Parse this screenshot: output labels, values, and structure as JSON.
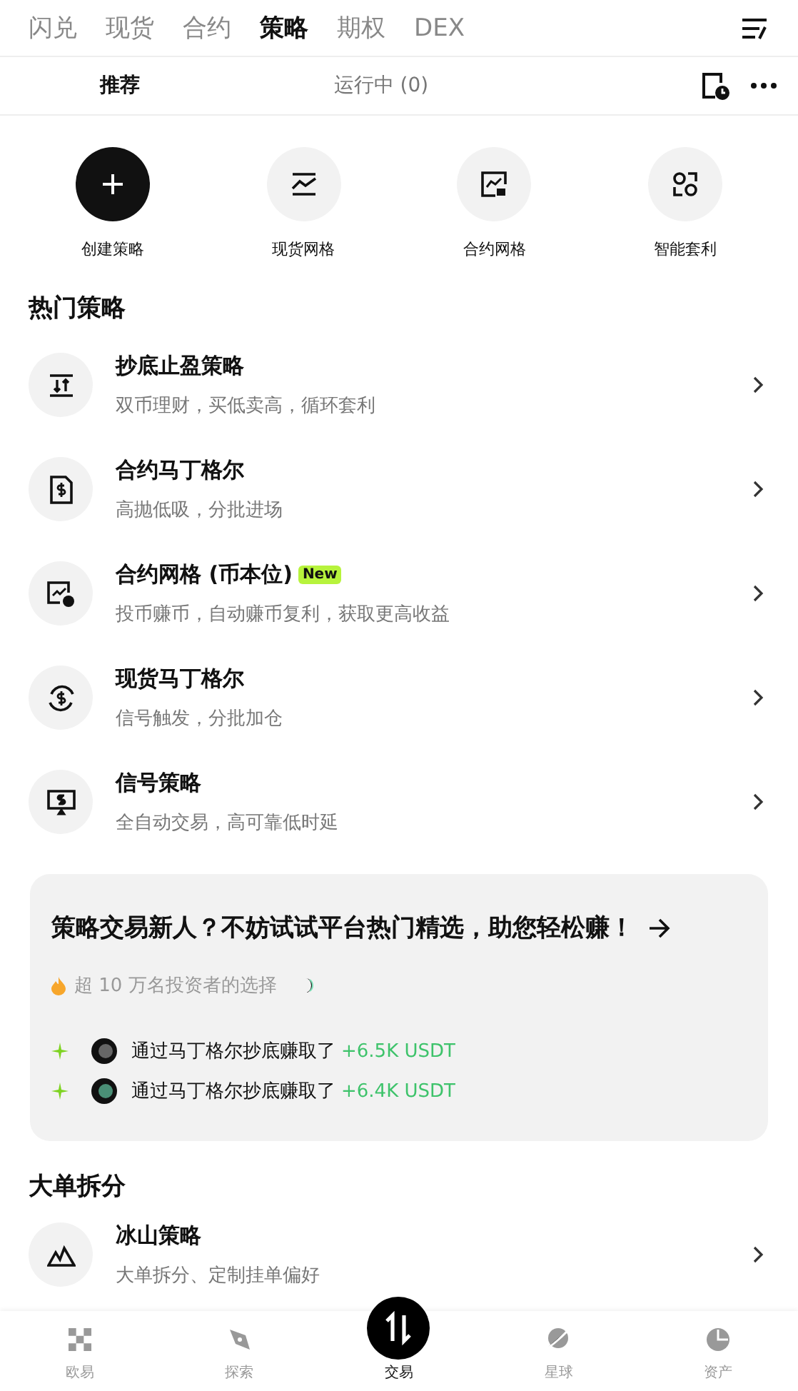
{
  "top_tabs": [
    {
      "label": "闪兑",
      "selected": false
    },
    {
      "label": "现货",
      "selected": false
    },
    {
      "label": "合约",
      "selected": false
    },
    {
      "label": "策略",
      "selected": true
    },
    {
      "label": "期权",
      "selected": false
    },
    {
      "label": "DEX",
      "selected": false
    }
  ],
  "sub_tabs": [
    {
      "label": "推荐",
      "selected": true
    },
    {
      "label": "运行中 (0)",
      "selected": false
    }
  ],
  "quick_actions": [
    {
      "label": "创建策略",
      "kind": "plus"
    },
    {
      "label": "现货网格",
      "kind": "grid"
    },
    {
      "label": "合约网格",
      "kind": "futures"
    },
    {
      "label": "智能套利",
      "kind": "arb"
    }
  ],
  "hot_section": {
    "title": "热门策略",
    "items": [
      {
        "kind": "dip",
        "title": "抄底止盈策略",
        "subtitle": "双币理财，买低卖高，循环套利"
      },
      {
        "kind": "doc",
        "title": "合约马丁格尔",
        "subtitle": "高抛低吸，分批进场"
      },
      {
        "kind": "chart",
        "title": "合约网格 (币本位)",
        "badge": "New",
        "subtitle": "投币赚币，自动赚币复利，获取更高收益"
      },
      {
        "kind": "cycle",
        "title": "现货马丁格尔",
        "subtitle": "信号触发，分批加仓"
      },
      {
        "kind": "signal",
        "title": "信号策略",
        "subtitle": "全自动交易，高可靠低时延"
      }
    ]
  },
  "promo": {
    "title": "策略交易新人？不妨试试平台热门精选，助您轻松赚！",
    "caption": "超 10 万名投资者的选择",
    "feed": [
      {
        "text": "通过马丁格尔抄底赚取了",
        "amount": "+6.5K USDT"
      },
      {
        "text": "通过马丁格尔抄底赚取了",
        "amount": "+6.4K USDT"
      }
    ]
  },
  "split_section": {
    "title": "大单拆分",
    "items": [
      {
        "kind": "mountain",
        "title": "冰山策略",
        "subtitle": "大单拆分、定制挂单偏好"
      }
    ]
  },
  "bottom_nav": [
    {
      "label": "欧易",
      "kind": "grid",
      "selected": false
    },
    {
      "label": "探索",
      "kind": "compass",
      "selected": false
    },
    {
      "label": "交易",
      "kind": "trade",
      "selected": true
    },
    {
      "label": "星球",
      "kind": "planet",
      "selected": false
    },
    {
      "label": "资产",
      "kind": "pie",
      "selected": false
    }
  ]
}
